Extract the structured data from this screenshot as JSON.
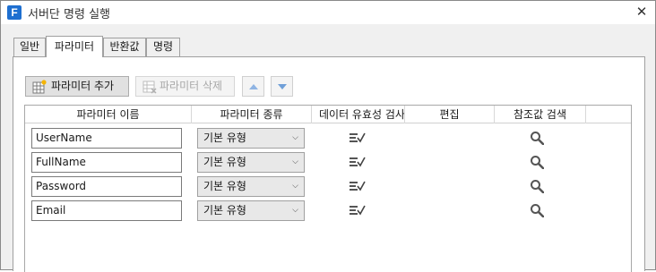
{
  "window": {
    "app_icon_letter": "F",
    "title": "서버단 명령 실행",
    "close_glyph": "✕"
  },
  "tabs": [
    {
      "label": "일반",
      "active": false
    },
    {
      "label": "파라미터",
      "active": true
    },
    {
      "label": "반환값",
      "active": false
    },
    {
      "label": "명령",
      "active": false
    }
  ],
  "toolbar": {
    "add_label": "파라미터 추가",
    "delete_label": "파라미터 삭제",
    "move_up_icon": "arrow-up-icon",
    "move_down_icon": "arrow-down-icon"
  },
  "grid": {
    "columns": [
      "파라미터 이름",
      "파라미터 종류",
      "데이터 유효성 검사",
      "편집",
      "참조값 검색"
    ],
    "rows": [
      {
        "name": "UserName",
        "type": "기본 유형"
      },
      {
        "name": "FullName",
        "type": "기본 유형"
      },
      {
        "name": "Password",
        "type": "기본 유형"
      },
      {
        "name": "Email",
        "type": "기본 유형"
      }
    ]
  },
  "colors": {
    "accent": "#1e6fd0",
    "arrow": "#6f9fd8"
  }
}
